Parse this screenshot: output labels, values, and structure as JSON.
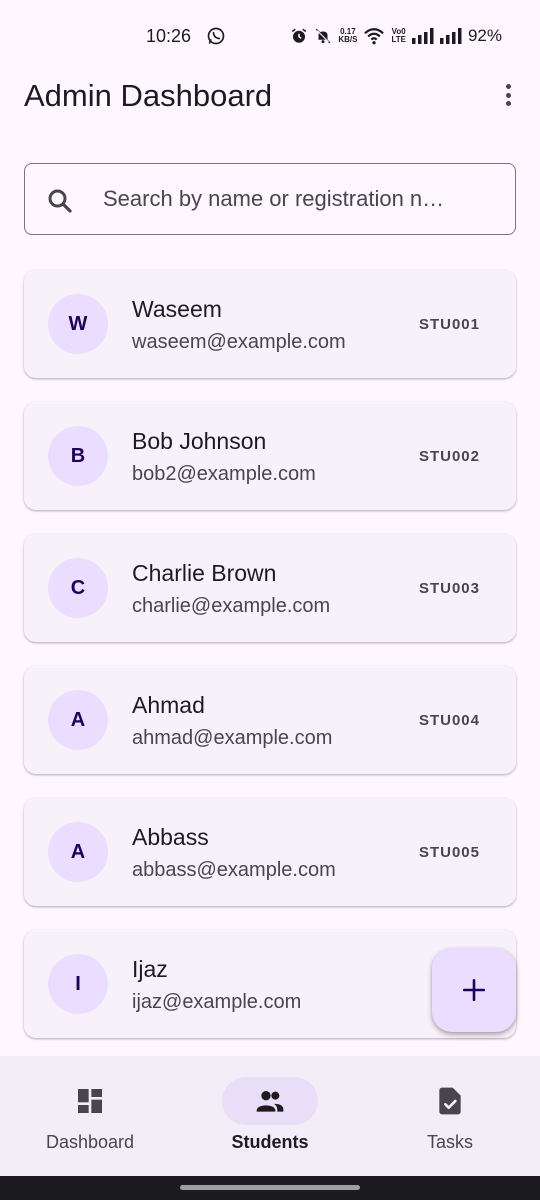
{
  "status_bar": {
    "time": "10:26",
    "speed_top": "0.17",
    "speed_bottom": "KB/S",
    "volte_top": "Vo0",
    "volte_bottom": "LTE",
    "battery": "92%"
  },
  "app_bar": {
    "title": "Admin Dashboard"
  },
  "search": {
    "placeholder": "Search by name or registration n…"
  },
  "students": [
    {
      "initial": "W",
      "name": "Waseem",
      "email": "waseem@example.com",
      "reg": "STU001"
    },
    {
      "initial": "B",
      "name": "Bob Johnson",
      "email": "bob2@example.com",
      "reg": "STU002"
    },
    {
      "initial": "C",
      "name": "Charlie Brown",
      "email": "charlie@example.com",
      "reg": "STU003"
    },
    {
      "initial": "A",
      "name": "Ahmad",
      "email": "ahmad@example.com",
      "reg": "STU004"
    },
    {
      "initial": "A",
      "name": "Abbass",
      "email": "abbass@example.com",
      "reg": "STU005"
    },
    {
      "initial": "I",
      "name": "Ijaz",
      "email": "ijaz@example.com",
      "reg": "ST"
    }
  ],
  "fab": {
    "icon": "add-icon"
  },
  "bottom_nav": {
    "items": [
      {
        "label": "Dashboard",
        "icon": "dashboard-icon",
        "active": false
      },
      {
        "label": "Students",
        "icon": "people-icon",
        "active": true
      },
      {
        "label": "Tasks",
        "icon": "task-icon",
        "active": false
      }
    ]
  },
  "colors": {
    "background": "#FEF7FF",
    "card": "#F7F2FA",
    "avatar": "#EADDFF",
    "nav_bar": "#F3EDF7",
    "nav_indicator": "#E8DEF8"
  }
}
